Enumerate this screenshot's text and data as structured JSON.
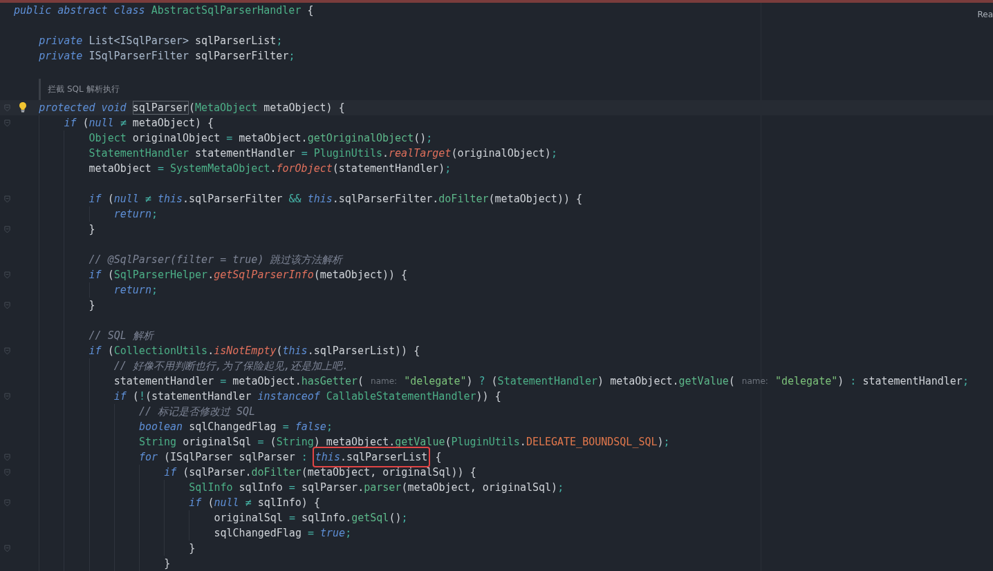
{
  "reader_mode_label": "Rea",
  "code": [
    {
      "kind": "code",
      "tokens": [
        {
          "kind": "kw",
          "text": "public abstract class "
        },
        {
          "kind": "type",
          "text": "AbstractSqlParserHandler"
        },
        {
          "kind": "plain",
          "text": " {"
        }
      ],
      "children": [
        {
          "kind": "blank"
        },
        {
          "kind": "code",
          "tokens": [
            {
              "kind": "kw",
              "text": "private "
            },
            {
              "kind": "iface",
              "text": "List<ISqlParser>"
            },
            {
              "kind": "plain",
              "text": " sqlParserList"
            },
            {
              "kind": "op",
              "text": ";"
            }
          ]
        },
        {
          "kind": "code",
          "tokens": [
            {
              "kind": "kw",
              "text": "private "
            },
            {
              "kind": "iface",
              "text": "ISqlParserFilter"
            },
            {
              "kind": "plain",
              "text": " sqlParserFilter"
            },
            {
              "kind": "op",
              "text": ";"
            }
          ]
        },
        {
          "kind": "blank"
        },
        {
          "kind": "doc",
          "text": "拦截 SQL 解析执行"
        },
        {
          "kind": "code",
          "fold": true,
          "current": true,
          "bulb": true,
          "tokens": [
            {
              "kind": "kw",
              "text": "protected void "
            },
            {
              "kind": "plain",
              "text": "sqlParser",
              "outlined": true
            },
            {
              "kind": "plain",
              "text": "("
            },
            {
              "kind": "type",
              "text": "MetaObject"
            },
            {
              "kind": "plain",
              "text": " metaObject) {"
            }
          ],
          "children": [
            {
              "kind": "code",
              "fold": true,
              "tokens": [
                {
                  "kind": "kw",
                  "text": "if "
                },
                {
                  "kind": "plain",
                  "text": "("
                },
                {
                  "kind": "kw",
                  "text": "null "
                },
                {
                  "kind": "op",
                  "text": "≠ "
                },
                {
                  "kind": "plain",
                  "text": "metaObject) {"
                }
              ],
              "children": [
                {
                  "kind": "code",
                  "tokens": [
                    {
                      "kind": "type",
                      "text": "Object"
                    },
                    {
                      "kind": "plain",
                      "text": " originalObject "
                    },
                    {
                      "kind": "op",
                      "text": "= "
                    },
                    {
                      "kind": "plain",
                      "text": "metaObject."
                    },
                    {
                      "kind": "method",
                      "text": "getOriginalObject"
                    },
                    {
                      "kind": "plain",
                      "text": "()"
                    },
                    {
                      "kind": "op",
                      "text": ";"
                    }
                  ]
                },
                {
                  "kind": "code",
                  "tokens": [
                    {
                      "kind": "type",
                      "text": "StatementHandler"
                    },
                    {
                      "kind": "plain",
                      "text": " statementHandler "
                    },
                    {
                      "kind": "op",
                      "text": "= "
                    },
                    {
                      "kind": "type",
                      "text": "PluginUtils"
                    },
                    {
                      "kind": "plain",
                      "text": "."
                    },
                    {
                      "kind": "static",
                      "text": "realTarget"
                    },
                    {
                      "kind": "plain",
                      "text": "(originalObject)"
                    },
                    {
                      "kind": "op",
                      "text": ";"
                    }
                  ]
                },
                {
                  "kind": "code",
                  "tokens": [
                    {
                      "kind": "plain",
                      "text": "metaObject "
                    },
                    {
                      "kind": "op",
                      "text": "= "
                    },
                    {
                      "kind": "type",
                      "text": "SystemMetaObject"
                    },
                    {
                      "kind": "plain",
                      "text": "."
                    },
                    {
                      "kind": "static",
                      "text": "forObject"
                    },
                    {
                      "kind": "plain",
                      "text": "(statementHandler)"
                    },
                    {
                      "kind": "op",
                      "text": ";"
                    }
                  ]
                },
                {
                  "kind": "blank"
                },
                {
                  "kind": "code",
                  "fold": true,
                  "tokens": [
                    {
                      "kind": "kw",
                      "text": "if "
                    },
                    {
                      "kind": "plain",
                      "text": "("
                    },
                    {
                      "kind": "kw",
                      "text": "null "
                    },
                    {
                      "kind": "op",
                      "text": "≠ "
                    },
                    {
                      "kind": "kw",
                      "text": "this"
                    },
                    {
                      "kind": "plain",
                      "text": ".sqlParserFilter "
                    },
                    {
                      "kind": "op",
                      "text": "&& "
                    },
                    {
                      "kind": "kw",
                      "text": "this"
                    },
                    {
                      "kind": "plain",
                      "text": ".sqlParserFilter."
                    },
                    {
                      "kind": "method",
                      "text": "doFilter"
                    },
                    {
                      "kind": "plain",
                      "text": "(metaObject)) {"
                    }
                  ],
                  "children": [
                    {
                      "kind": "code",
                      "tokens": [
                        {
                          "kind": "kw",
                          "text": "return"
                        },
                        {
                          "kind": "op",
                          "text": ";"
                        }
                      ]
                    }
                  ],
                  "end": {
                    "fold": true,
                    "tokens": [
                      {
                        "kind": "plain",
                        "text": "}"
                      }
                    ]
                  }
                },
                {
                  "kind": "blank"
                },
                {
                  "kind": "code",
                  "tokens": [
                    {
                      "kind": "comment",
                      "text": "// @SqlParser(filter = true) 跳过该方法解析"
                    }
                  ]
                },
                {
                  "kind": "code",
                  "fold": true,
                  "tokens": [
                    {
                      "kind": "kw",
                      "text": "if "
                    },
                    {
                      "kind": "plain",
                      "text": "("
                    },
                    {
                      "kind": "type",
                      "text": "SqlParserHelper"
                    },
                    {
                      "kind": "plain",
                      "text": "."
                    },
                    {
                      "kind": "static",
                      "text": "getSqlParserInfo"
                    },
                    {
                      "kind": "plain",
                      "text": "(metaObject)) {"
                    }
                  ],
                  "children": [
                    {
                      "kind": "code",
                      "tokens": [
                        {
                          "kind": "kw",
                          "text": "return"
                        },
                        {
                          "kind": "op",
                          "text": ";"
                        }
                      ]
                    }
                  ],
                  "end": {
                    "fold": true,
                    "tokens": [
                      {
                        "kind": "plain",
                        "text": "}"
                      }
                    ]
                  }
                },
                {
                  "kind": "blank"
                },
                {
                  "kind": "code",
                  "tokens": [
                    {
                      "kind": "comment",
                      "text": "// SQL 解析"
                    }
                  ]
                },
                {
                  "kind": "code",
                  "fold": true,
                  "tokens": [
                    {
                      "kind": "kw",
                      "text": "if "
                    },
                    {
                      "kind": "plain",
                      "text": "("
                    },
                    {
                      "kind": "type",
                      "text": "CollectionUtils"
                    },
                    {
                      "kind": "plain",
                      "text": "."
                    },
                    {
                      "kind": "static",
                      "text": "isNotEmpty"
                    },
                    {
                      "kind": "plain",
                      "text": "("
                    },
                    {
                      "kind": "kw",
                      "text": "this"
                    },
                    {
                      "kind": "plain",
                      "text": ".sqlParserList)) {"
                    }
                  ],
                  "children": [
                    {
                      "kind": "code",
                      "tokens": [
                        {
                          "kind": "comment",
                          "text": "// 好像不用判断也行,为了保险起见,还是加上吧."
                        }
                      ]
                    },
                    {
                      "kind": "code",
                      "tokens": [
                        {
                          "kind": "plain",
                          "text": "statementHandler "
                        },
                        {
                          "kind": "op",
                          "text": "= "
                        },
                        {
                          "kind": "plain",
                          "text": "metaObject."
                        },
                        {
                          "kind": "method",
                          "text": "hasGetter"
                        },
                        {
                          "kind": "plain",
                          "text": "( "
                        },
                        {
                          "kind": "hint",
                          "text": "name:"
                        },
                        {
                          "kind": "string",
                          "text": " \"delegate\""
                        },
                        {
                          "kind": "plain",
                          "text": ") "
                        },
                        {
                          "kind": "op",
                          "text": "? "
                        },
                        {
                          "kind": "plain",
                          "text": "("
                        },
                        {
                          "kind": "type",
                          "text": "StatementHandler"
                        },
                        {
                          "kind": "plain",
                          "text": ") metaObject."
                        },
                        {
                          "kind": "method",
                          "text": "getValue"
                        },
                        {
                          "kind": "plain",
                          "text": "( "
                        },
                        {
                          "kind": "hint",
                          "text": "name:"
                        },
                        {
                          "kind": "string",
                          "text": " \"delegate\""
                        },
                        {
                          "kind": "plain",
                          "text": ") "
                        },
                        {
                          "kind": "op",
                          "text": ": "
                        },
                        {
                          "kind": "plain",
                          "text": "statementHandler"
                        },
                        {
                          "kind": "op",
                          "text": ";"
                        }
                      ]
                    },
                    {
                      "kind": "code",
                      "fold": true,
                      "tokens": [
                        {
                          "kind": "kw",
                          "text": "if "
                        },
                        {
                          "kind": "plain",
                          "text": "("
                        },
                        {
                          "kind": "op",
                          "text": "!"
                        },
                        {
                          "kind": "plain",
                          "text": "(statementHandler "
                        },
                        {
                          "kind": "kw",
                          "text": "instanceof "
                        },
                        {
                          "kind": "type",
                          "text": "CallableStatementHandler"
                        },
                        {
                          "kind": "plain",
                          "text": ")) {"
                        }
                      ],
                      "children": [
                        {
                          "kind": "code",
                          "tokens": [
                            {
                              "kind": "comment",
                              "text": "// 标记是否修改过 SQL"
                            }
                          ]
                        },
                        {
                          "kind": "code",
                          "tokens": [
                            {
                              "kind": "kw",
                              "text": "boolean "
                            },
                            {
                              "kind": "plain",
                              "text": "sqlChangedFlag "
                            },
                            {
                              "kind": "op",
                              "text": "= "
                            },
                            {
                              "kind": "kw",
                              "text": "false"
                            },
                            {
                              "kind": "op",
                              "text": ";"
                            }
                          ]
                        },
                        {
                          "kind": "code",
                          "tokens": [
                            {
                              "kind": "type",
                              "text": "String"
                            },
                            {
                              "kind": "plain",
                              "text": " originalSql "
                            },
                            {
                              "kind": "op",
                              "text": "= "
                            },
                            {
                              "kind": "plain",
                              "text": "("
                            },
                            {
                              "kind": "type",
                              "text": "String"
                            },
                            {
                              "kind": "plain",
                              "text": ") metaObject."
                            },
                            {
                              "kind": "method",
                              "text": "getValue"
                            },
                            {
                              "kind": "plain",
                              "text": "("
                            },
                            {
                              "kind": "type",
                              "text": "PluginUtils"
                            },
                            {
                              "kind": "plain",
                              "text": "."
                            },
                            {
                              "kind": "const",
                              "text": "DELEGATE_BOUNDSQL_SQL"
                            },
                            {
                              "kind": "plain",
                              "text": ")"
                            },
                            {
                              "kind": "op",
                              "text": ";"
                            }
                          ]
                        },
                        {
                          "kind": "code",
                          "fold": true,
                          "tokens": [
                            {
                              "kind": "kw",
                              "text": "for "
                            },
                            {
                              "kind": "plain",
                              "text": "(ISqlParser sqlParser "
                            },
                            {
                              "kind": "op",
                              "text": ": "
                            },
                            {
                              "kind": "kw",
                              "text": "this",
                              "boxed": true
                            },
                            {
                              "kind": "plain",
                              "text": ".sqlParserList",
                              "boxed": true
                            },
                            {
                              "kind": "plain",
                              "text": " {"
                            }
                          ],
                          "children": [
                            {
                              "kind": "code",
                              "fold": true,
                              "tokens": [
                                {
                                  "kind": "kw",
                                  "text": "if "
                                },
                                {
                                  "kind": "plain",
                                  "text": "(sqlParser."
                                },
                                {
                                  "kind": "method",
                                  "text": "doFilter"
                                },
                                {
                                  "kind": "plain",
                                  "text": "(metaObject, originalSql)) {"
                                }
                              ],
                              "children": [
                                {
                                  "kind": "code",
                                  "tokens": [
                                    {
                                      "kind": "type",
                                      "text": "SqlInfo"
                                    },
                                    {
                                      "kind": "plain",
                                      "text": " sqlInfo "
                                    },
                                    {
                                      "kind": "op",
                                      "text": "= "
                                    },
                                    {
                                      "kind": "plain",
                                      "text": "sqlParser."
                                    },
                                    {
                                      "kind": "method",
                                      "text": "parser"
                                    },
                                    {
                                      "kind": "plain",
                                      "text": "(metaObject, originalSql)"
                                    },
                                    {
                                      "kind": "op",
                                      "text": ";"
                                    }
                                  ]
                                },
                                {
                                  "kind": "code",
                                  "fold": true,
                                  "tokens": [
                                    {
                                      "kind": "kw",
                                      "text": "if "
                                    },
                                    {
                                      "kind": "plain",
                                      "text": "("
                                    },
                                    {
                                      "kind": "kw",
                                      "text": "null "
                                    },
                                    {
                                      "kind": "op",
                                      "text": "≠ "
                                    },
                                    {
                                      "kind": "plain",
                                      "text": "sqlInfo) {"
                                    }
                                  ],
                                  "children": [
                                    {
                                      "kind": "code",
                                      "tokens": [
                                        {
                                          "kind": "plain",
                                          "text": "originalSql "
                                        },
                                        {
                                          "kind": "op",
                                          "text": "= "
                                        },
                                        {
                                          "kind": "plain",
                                          "text": "sqlInfo."
                                        },
                                        {
                                          "kind": "method",
                                          "text": "getSql"
                                        },
                                        {
                                          "kind": "plain",
                                          "text": "()"
                                        },
                                        {
                                          "kind": "op",
                                          "text": ";"
                                        }
                                      ]
                                    },
                                    {
                                      "kind": "code",
                                      "tokens": [
                                        {
                                          "kind": "plain",
                                          "text": "sqlChangedFlag "
                                        },
                                        {
                                          "kind": "op",
                                          "text": "= "
                                        },
                                        {
                                          "kind": "kw",
                                          "text": "true"
                                        },
                                        {
                                          "kind": "op",
                                          "text": ";"
                                        }
                                      ]
                                    }
                                  ],
                                  "end": {
                                    "fold": true,
                                    "tokens": [
                                      {
                                        "kind": "plain",
                                        "text": "}"
                                      }
                                    ]
                                  }
                                }
                              ],
                              "end": {
                                "tokens": [
                                  {
                                    "kind": "plain",
                                    "text": "}"
                                  }
                                ]
                              }
                            }
                          ]
                        }
                      ]
                    }
                  ]
                }
              ]
            }
          ]
        }
      ]
    }
  ]
}
